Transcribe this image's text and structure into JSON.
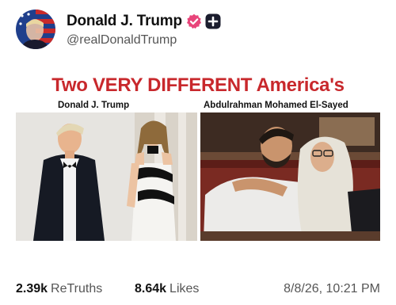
{
  "post": {
    "author": {
      "display_name": "Donald J. Trump",
      "handle": "@realDonaldTrump",
      "avatar_icon": "avatar-flag-portrait",
      "verified_icon": "verified-badge-icon",
      "plus_icon": "plus-badge-icon"
    },
    "image": {
      "headline": "Two VERY DIFFERENT America's",
      "left_caption": "Donald J. Trump",
      "right_caption": "Abdulrahman Mohamed El-Sayed"
    },
    "stats": {
      "retruths_count": "2.39k",
      "retruths_label": "ReTruths",
      "likes_count": "8.64k",
      "likes_label": "Likes",
      "timestamp": "8/8/26, 10:21 PM"
    }
  },
  "colors": {
    "headline_red": "#c8282c",
    "verified_pink": "#e8457a",
    "text_secondary": "#555555"
  }
}
